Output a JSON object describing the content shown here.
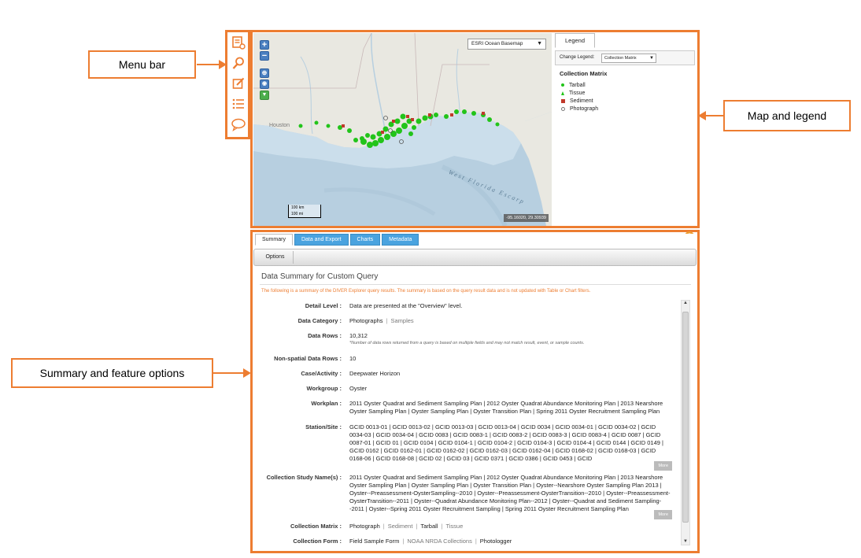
{
  "callouts": {
    "menu_bar": "Menu bar",
    "map_legend": "Map and legend",
    "summary_options": "Summary and feature options"
  },
  "map": {
    "basemap": "ESRI Ocean Basemap",
    "labels": {
      "houston": "Houston",
      "west_florida": "West Florida Escarp"
    },
    "coords": "-95.16020, 29.30939",
    "scale_km": "100 km",
    "scale_mi": "100 mi"
  },
  "legend": {
    "tab": "Legend",
    "change_label": "Change Legend:",
    "change_value": "Collection Matrix",
    "title": "Collection Matrix",
    "items": [
      {
        "label": "Tarball",
        "color": "#22c41a",
        "shape": "dot"
      },
      {
        "label": "Tissue",
        "color": "#22c41a",
        "shape": "triangle"
      },
      {
        "label": "Sediment",
        "color": "#c0392b",
        "shape": "square"
      },
      {
        "label": "Photograph",
        "color": "#777777",
        "shape": "circle"
      }
    ]
  },
  "panel": {
    "tabs": [
      "Summary",
      "Data and Export",
      "Charts",
      "Metadata"
    ],
    "options_btn": "Options",
    "heading": "Data Summary for Custom Query",
    "notice": "The following is a summary of the DIVER Explorer query results. The summary is based on the query result data and is not updated with Table or Chart filters.",
    "more": "More",
    "detail_level": {
      "label": "Detail Level :",
      "value": "Data are presented at the \"Overview\" level."
    },
    "data_category": {
      "label": "Data Category :",
      "bold": "Photographs",
      "dim": "Samples"
    },
    "data_rows": {
      "label": "Data Rows :",
      "value": "10,312",
      "note": "*Number of data rows returned from a query is based on multiple fields and may not match result, event, or sample counts."
    },
    "non_spatial": {
      "label": "Non-spatial Data Rows :",
      "value": "10"
    },
    "case": {
      "label": "Case/Activity :",
      "value": "Deepwater Horizon"
    },
    "workgroup": {
      "label": "Workgroup :",
      "value": "Oyster"
    },
    "workplan": {
      "label": "Workplan :",
      "text": "2011 Oyster Quadrat and Sediment Sampling Plan | 2012 Oyster Quadrat Abundance Monitoring Plan | 2013 Nearshore Oyster Sampling Plan | Oyster Sampling Plan | Oyster Transition Plan | Spring 2011 Oyster Recruitment Sampling Plan"
    },
    "station": {
      "label": "Station/Site :",
      "text": "GCID 0013-01 | GCID 0013-02 | GCID 0013-03 | GCID 0013-04 | GCID 0034 | GCID 0034-01 | GCID 0034-02 | GCID 0034-03 | GCID 0034-04 | GCID 0083 | GCID 0083-1 | GCID 0083-2 | GCID 0083-3 | GCID 0083-4 | GCID 0087 | GCID 0087-01 | GCID 01 | GCID 0104 | GCID 0104-1 | GCID 0104-2 | GCID 0104-3 | GCID 0104-4 | GCID 0144 | GCID 0149 | GCID 0162 | GCID 0162-01 | GCID 0162-02 | GCID 0162-03 | GCID 0162-04 | GCID 0168-02 | GCID 0168-03 | GCID 0168-06 | GCID 0168-08 | GCID 02 | GCID 03 | GCID 0371 | GCID 0386 | GCID 0453 | GCID"
    },
    "study": {
      "label": "Collection Study Name(s) :",
      "text": "2011 Oyster Quadrat and Sediment Sampling Plan | 2012 Oyster Quadrat Abundance Monitoring Plan | 2013 Nearshore Oyster Sampling Plan | Oyster Sampling Plan | Oyster Transition Plan | Oyster--Nearshore Oyster Sampling Plan 2013 | Oyster--Preassessment-OysterSampling--2010 | Oyster--Preassessment-OysterTransition--2010 | Oyster--Preassessment-OysterTransition--2011 | Oyster--Quadrat Abundance Monitoring Plan--2012 | Oyster--Quadrat and Sediment Sampling--2011 | Oyster--Spring 2011 Oyster Recruitment Sampling | Spring 2011 Oyster Recruitment Sampling Plan"
    },
    "matrix": {
      "label": "Collection Matrix :",
      "parts": [
        "Photograph",
        "Sediment",
        "Tarball",
        "Tissue"
      ]
    },
    "form": {
      "label": "Collection Form :",
      "parts": [
        "Field Sample Form",
        "NOAA NRDA Collections",
        "Photologger"
      ]
    }
  }
}
